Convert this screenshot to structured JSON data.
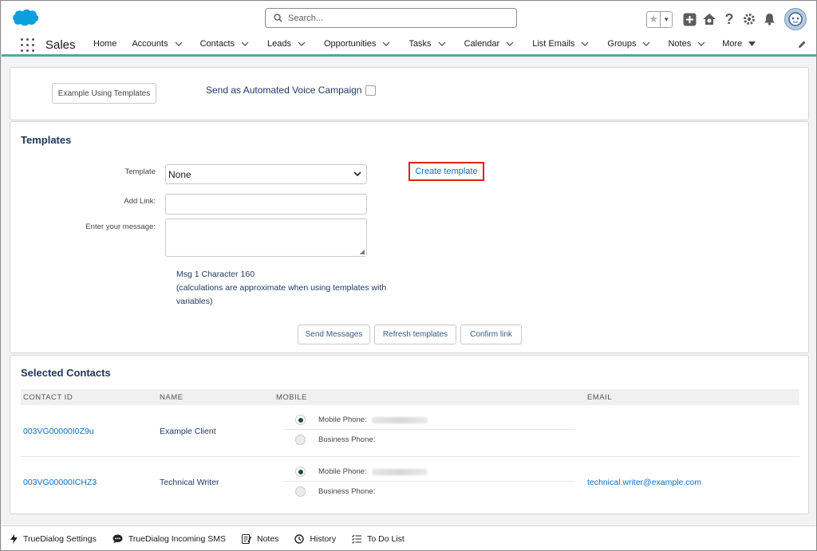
{
  "header": {
    "search_placeholder": "Search..."
  },
  "nav": {
    "app_name": "Sales",
    "items": [
      {
        "label": "Home",
        "chevron": false
      },
      {
        "label": "Accounts",
        "chevron": true
      },
      {
        "label": "Contacts",
        "chevron": true
      },
      {
        "label": "Leads",
        "chevron": true
      },
      {
        "label": "Opportunities",
        "chevron": true
      },
      {
        "label": "Tasks",
        "chevron": true
      },
      {
        "label": "Calendar",
        "chevron": true
      },
      {
        "label": "List Emails",
        "chevron": true
      },
      {
        "label": "Groups",
        "chevron": true
      },
      {
        "label": "Notes",
        "chevron": true
      },
      {
        "label": "More",
        "chevron": true
      }
    ]
  },
  "campaign": {
    "example_button": "Example Using Templates",
    "voice_label": "Send as Automated Voice Campaign",
    "voice_checked": false
  },
  "templates": {
    "title": "Templates",
    "template_label": "Template",
    "template_value": "None",
    "link_label": "Add Link:",
    "link_value": "",
    "message_label": "Enter your message:",
    "message_value": "",
    "create_link": "Create template",
    "msg_line1": "Msg 1 Character 160",
    "msg_line2": "(calculations are approximate when using templates with",
    "msg_line3": "variables)",
    "send_button": "Send Messages",
    "refresh_button": "Refresh templates",
    "confirm_button": "Confirm link"
  },
  "contacts": {
    "title": "Selected Contacts",
    "columns": [
      "CONTACT ID",
      "NAME",
      "MOBILE",
      "EMAIL"
    ],
    "mobile_phone_label": "Mobile Phone:",
    "business_phone_label": "Business Phone:",
    "rows": [
      {
        "id": "003VG00000I0Z9u",
        "name": "Example Client",
        "email": "",
        "mobile_selected": true
      },
      {
        "id": "003VG00000ICHZ3",
        "name": "Technical Writer",
        "email": "technical.writer@example.com",
        "mobile_selected": true
      }
    ]
  },
  "footer": {
    "items": [
      "TrueDialog Settings",
      "TrueDialog Incoming SMS",
      "Notes",
      "History",
      "To Do List"
    ]
  },
  "colors": {
    "accent": "#54a796",
    "link": "#0a6fcf",
    "highlight": "#e0201f",
    "heading": "#1d3557"
  }
}
